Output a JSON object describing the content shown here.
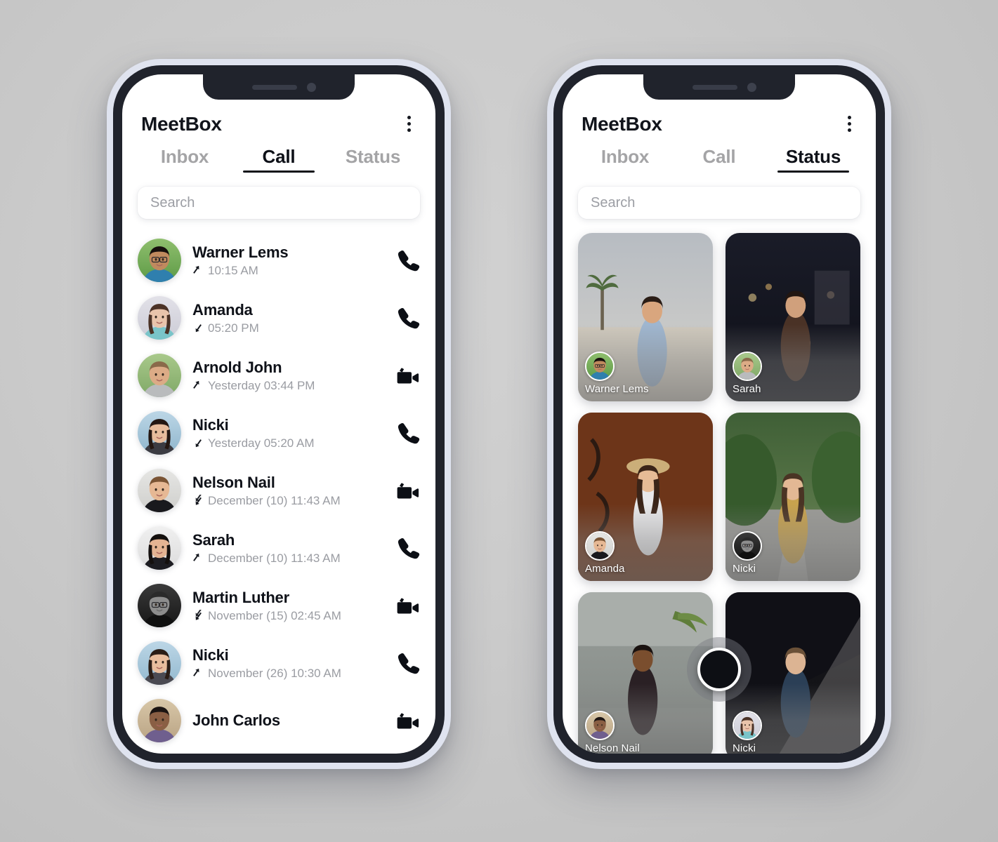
{
  "app": {
    "title": "MeetBox",
    "menu_icon": "kebab-menu-icon"
  },
  "tabs": [
    {
      "label": "Inbox"
    },
    {
      "label": "Call"
    },
    {
      "label": "Status"
    }
  ],
  "search": {
    "placeholder": "Search",
    "value": ""
  },
  "call_screen": {
    "active_tab": "Call",
    "calls": [
      {
        "name": "Warner Lems",
        "time": "10:15 AM",
        "direction": "outgoing",
        "action": "voice"
      },
      {
        "name": "Amanda",
        "time": "05:20 PM",
        "direction": "incoming",
        "action": "voice"
      },
      {
        "name": "Arnold John",
        "time": "Yesterday 03:44 PM",
        "direction": "outgoing",
        "action": "video"
      },
      {
        "name": "Nicki",
        "time": "Yesterday 05:20 AM",
        "direction": "incoming",
        "action": "voice"
      },
      {
        "name": "Nelson Nail",
        "time": "December (10) 11:43 AM",
        "direction": "missed",
        "action": "video"
      },
      {
        "name": "Sarah",
        "time": "December (10) 11:43 AM",
        "direction": "outgoing",
        "action": "voice"
      },
      {
        "name": "Martin Luther",
        "time": "November (15) 02:45 AM",
        "direction": "missed",
        "action": "video"
      },
      {
        "name": "Nicki",
        "time": "November (26) 10:30 AM",
        "direction": "outgoing",
        "action": "voice"
      },
      {
        "name": "John Carlos",
        "time": "",
        "direction": "none",
        "action": "video"
      }
    ]
  },
  "status_screen": {
    "active_tab": "Status",
    "statuses": [
      {
        "name": "Warner Lems"
      },
      {
        "name": "Sarah"
      },
      {
        "name": "Amanda"
      },
      {
        "name": "Nicki"
      },
      {
        "name": "Nelson Nail"
      },
      {
        "name": "Nicki"
      }
    ],
    "fab": "camera-capture-button"
  },
  "colors": {
    "accent": "#0e1118",
    "muted": "#9a9ca2",
    "frame": "#20232c",
    "frame_ring": "#dfe3ef",
    "background": "#c8c8c8"
  }
}
